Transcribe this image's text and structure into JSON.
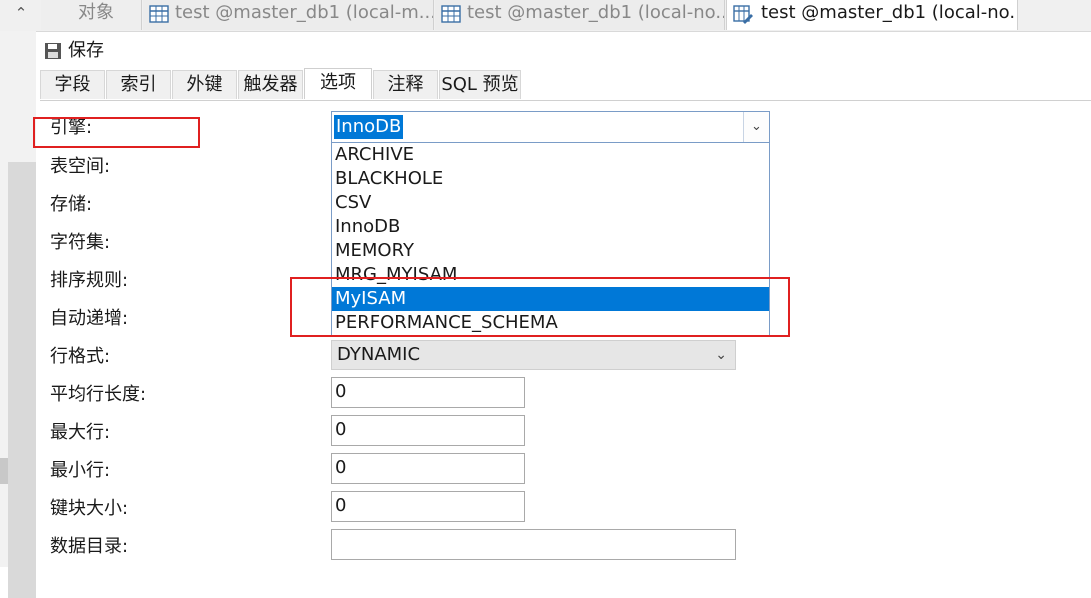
{
  "tabs": [
    {
      "label": "对象",
      "icon": null
    },
    {
      "label": "test @master_db1 (local-m...",
      "icon": "table-icon"
    },
    {
      "label": "test @master_db1 (local-no...",
      "icon": "table-icon"
    },
    {
      "label": "test @master_db1 (local-no...",
      "icon": "table-edit-icon",
      "active": true
    }
  ],
  "toolbar": {
    "save_label": "保存",
    "save_icon": "save-icon"
  },
  "subtabs": [
    "字段",
    "索引",
    "外键",
    "触发器",
    "选项",
    "注释",
    "SQL 预览"
  ],
  "active_subtab": "选项",
  "form": {
    "engine_label": "引擎:",
    "tablespace_label": "表空间:",
    "storage_label": "存储:",
    "charset_label": "字符集:",
    "collation_label": "排序规则:",
    "auto_increment_label": "自动递增:",
    "row_format_label": "行格式:",
    "avg_row_length_label": "平均行长度:",
    "max_rows_label": "最大行:",
    "min_rows_label": "最小行:",
    "key_block_size_label": "键块大小:",
    "data_directory_label": "数据目录:",
    "engine_value": "InnoDB",
    "row_format_value": "DYNAMIC",
    "avg_row_length_value": "0",
    "max_rows_value": "0",
    "min_rows_value": "0",
    "key_block_size_value": "0",
    "data_directory_value": ""
  },
  "engine_options": [
    "ARCHIVE",
    "BLACKHOLE",
    "CSV",
    "InnoDB",
    "MEMORY",
    "MRG_MYISAM",
    "MyISAM",
    "PERFORMANCE_SCHEMA"
  ],
  "engine_highlighted": "MyISAM",
  "colors": {
    "selection": "#0078d7",
    "annotation": "#e02020"
  }
}
